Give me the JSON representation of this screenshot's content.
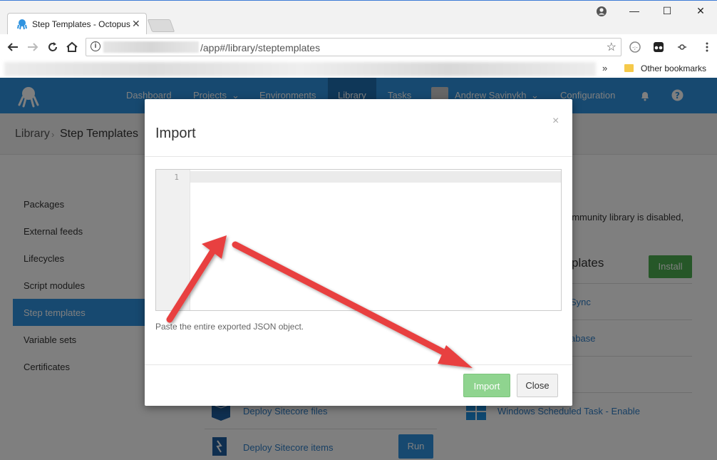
{
  "browser": {
    "tab_title": "Step Templates - Octopus Deploy",
    "url_path": "/app#/library/steptemplates",
    "other_bookmarks": "Other bookmarks",
    "bookmarks_chevron": "»",
    "tab_close": "✕",
    "win_min": "—",
    "win_max": "☐",
    "win_close": "✕"
  },
  "nav": {
    "items": [
      "Dashboard",
      "Projects",
      "Environments",
      "Library",
      "Tasks",
      "Andrew Savinykh",
      "Configuration"
    ]
  },
  "breadcrumb": {
    "root": "Library",
    "sep": "›",
    "current": "Step Templates"
  },
  "sidebar": {
    "items": [
      "Packages",
      "External feeds",
      "Lifecycles",
      "Script modules",
      "Step templates",
      "Variable sets",
      "Certificates"
    ]
  },
  "content": {
    "community_notice": "ommunity library is disabled,",
    "templates_heading": "plates",
    "install_label": "Install",
    "row_sync": "Sync",
    "row_base": "abase",
    "row_sitecore_files": "Deploy Sitecore files",
    "row_sitecore_items": "Deploy Sitecore items",
    "row_sched_task": "Windows Scheduled Task - Enable",
    "run_label": "Run"
  },
  "modal": {
    "title": "Import",
    "close_x": "×",
    "line_number": "1",
    "editor_value": "",
    "help_text": "Paste the entire exported JSON object.",
    "import_label": "Import",
    "close_label": "Close"
  },
  "colors": {
    "primary": "#2f93e0",
    "success": "#4caf50",
    "arrow": "#e8413f"
  }
}
